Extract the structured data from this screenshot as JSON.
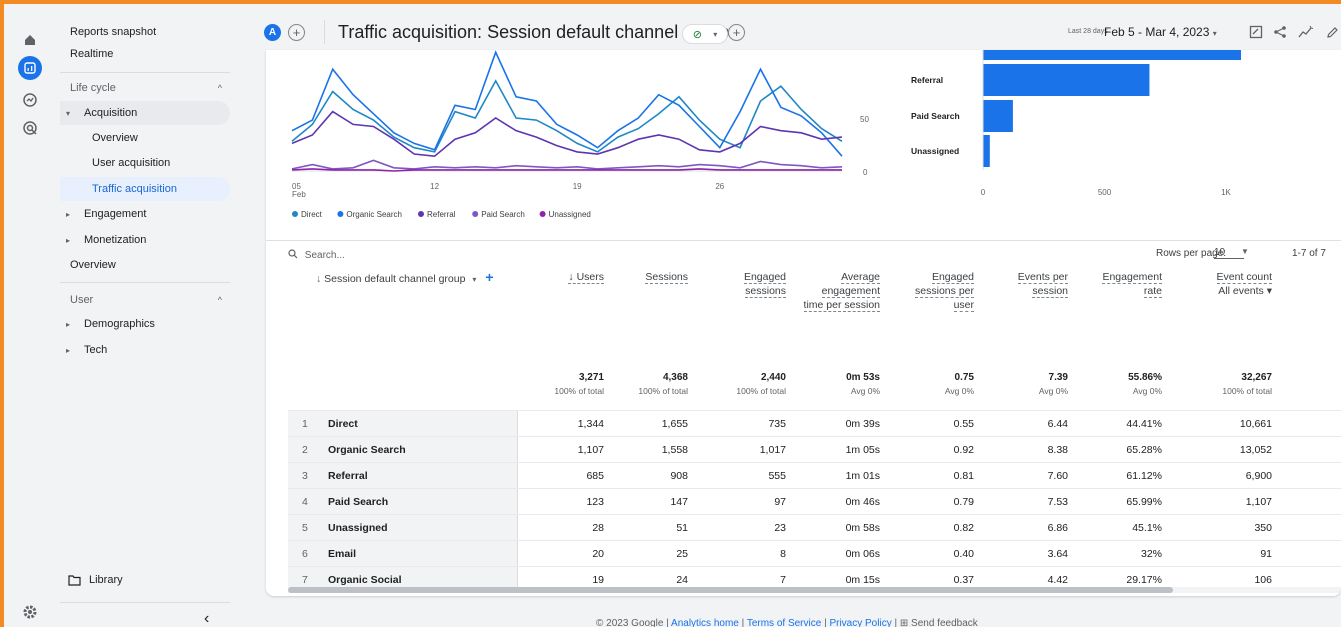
{
  "rail": {
    "icons": [
      "home-icon",
      "reports-icon",
      "explore-icon",
      "advertising-icon",
      "settings-icon"
    ]
  },
  "sidebar": {
    "reports_snapshot": "Reports snapshot",
    "realtime": "Realtime",
    "life_cycle": "Life cycle",
    "acquisition": "Acquisition",
    "overview": "Overview",
    "user_acquisition": "User acquisition",
    "traffic_acquisition": "Traffic acquisition",
    "engagement": "Engagement",
    "monetization": "Monetization",
    "overview2": "Overview",
    "user": "User",
    "demographics": "Demographics",
    "tech": "Tech",
    "library": "Library",
    "collapse": "‹"
  },
  "header": {
    "comparison_badge": "A",
    "title": "Traffic acquisition: Session default channel group",
    "date_label": "Last 28 days",
    "date_range": "Feb 5 - Mar 4, 2023"
  },
  "chart_data": [
    {
      "type": "line",
      "x_ticks": [
        "05\nFeb",
        "12",
        "19",
        "26"
      ],
      "y_ticks": [
        "50",
        "0"
      ],
      "series": [
        {
          "name": "Direct",
          "color": "#1e88c7",
          "values": [
            28,
            44,
            75,
            58,
            48,
            32,
            22,
            18,
            56,
            50,
            85,
            50,
            48,
            38,
            26,
            18,
            32,
            40,
            54,
            70,
            48,
            30,
            22,
            66,
            80,
            58,
            40,
            28
          ]
        },
        {
          "name": "Organic Search",
          "color": "#1a73e8",
          "values": [
            38,
            48,
            96,
            72,
            54,
            36,
            26,
            20,
            62,
            58,
            112,
            70,
            66,
            44,
            34,
            22,
            38,
            50,
            72,
            62,
            42,
            22,
            56,
            96,
            60,
            52,
            36,
            14
          ]
        },
        {
          "name": "Referral",
          "color": "#5e35b1",
          "values": [
            26,
            34,
            56,
            44,
            42,
            30,
            16,
            14,
            30,
            36,
            50,
            38,
            32,
            24,
            18,
            16,
            22,
            30,
            34,
            30,
            20,
            18,
            26,
            42,
            38,
            36,
            30,
            32
          ]
        },
        {
          "name": "Paid Search",
          "color": "#7e57c2",
          "values": [
            2,
            6,
            2,
            3,
            10,
            3,
            2,
            4,
            3,
            4,
            3,
            5,
            4,
            3,
            4,
            2,
            3,
            4,
            5,
            4,
            6,
            5,
            3,
            9,
            6,
            5,
            3,
            4
          ]
        },
        {
          "name": "Unassigned",
          "color": "#8e24aa",
          "values": [
            1,
            2,
            1,
            1,
            1,
            0,
            1,
            1,
            1,
            1,
            1,
            1,
            1,
            1,
            1,
            1,
            1,
            1,
            1,
            1,
            2,
            1,
            1,
            1,
            1,
            1,
            1,
            1
          ]
        }
      ],
      "xlabel": "",
      "ylabel": ""
    },
    {
      "type": "bar",
      "orientation": "horizontal",
      "categories": [
        "Referral",
        "Paid Search",
        "Unassigned"
      ],
      "values": [
        685,
        123,
        28
      ],
      "x_ticks": [
        "0",
        "500",
        "1K"
      ],
      "xlim": [
        0,
        1200
      ],
      "color": "#1a73e8"
    }
  ],
  "table": {
    "search_placeholder": "Search...",
    "rows_per_page_label": "Rows per page:",
    "rows_per_page_value": "10",
    "page_count": "1-7 of 7",
    "dimension_header": "Session default channel group",
    "columns": [
      {
        "label": "↓ Users",
        "total": "3,271",
        "sub": "100% of total"
      },
      {
        "label": "Sessions",
        "total": "4,368",
        "sub": "100% of total"
      },
      {
        "label": "Engaged sessions",
        "total": "2,440",
        "sub": "100% of total"
      },
      {
        "label": "Average engagement time per session",
        "total": "0m 53s",
        "sub": "Avg 0%"
      },
      {
        "label": "Engaged sessions per user",
        "total": "0.75",
        "sub": "Avg 0%"
      },
      {
        "label": "Events per session",
        "total": "7.39",
        "sub": "Avg 0%"
      },
      {
        "label": "Engagement rate",
        "total": "55.86%",
        "sub": "Avg 0%"
      },
      {
        "label": "Event count",
        "total": "32,267",
        "sub": "100% of total"
      }
    ],
    "event_count_filter": "All events",
    "rows": [
      {
        "rank": "1",
        "name": "Direct",
        "cells": [
          "1,344",
          "1,655",
          "735",
          "0m 39s",
          "0.55",
          "6.44",
          "44.41%",
          "10,661"
        ]
      },
      {
        "rank": "2",
        "name": "Organic Search",
        "cells": [
          "1,107",
          "1,558",
          "1,017",
          "1m 05s",
          "0.92",
          "8.38",
          "65.28%",
          "13,052"
        ]
      },
      {
        "rank": "3",
        "name": "Referral",
        "cells": [
          "685",
          "908",
          "555",
          "1m 01s",
          "0.81",
          "7.60",
          "61.12%",
          "6,900"
        ]
      },
      {
        "rank": "4",
        "name": "Paid Search",
        "cells": [
          "123",
          "147",
          "97",
          "0m 46s",
          "0.79",
          "7.53",
          "65.99%",
          "1,107"
        ]
      },
      {
        "rank": "5",
        "name": "Unassigned",
        "cells": [
          "28",
          "51",
          "23",
          "0m 58s",
          "0.82",
          "6.86",
          "45.1%",
          "350"
        ]
      },
      {
        "rank": "6",
        "name": "Email",
        "cells": [
          "20",
          "25",
          "8",
          "0m 06s",
          "0.40",
          "3.64",
          "32%",
          "91"
        ]
      },
      {
        "rank": "7",
        "name": "Organic Social",
        "cells": [
          "19",
          "24",
          "7",
          "0m 15s",
          "0.37",
          "4.42",
          "29.17%",
          "106"
        ]
      }
    ]
  },
  "footer": {
    "copyright": "© 2023 Google | ",
    "analytics_home": "Analytics home",
    "sep1": " | ",
    "terms": "Terms of Service",
    "sep2": " | ",
    "privacy": "Privacy Policy",
    "sep3": " | ",
    "feedback": "Send feedback"
  }
}
